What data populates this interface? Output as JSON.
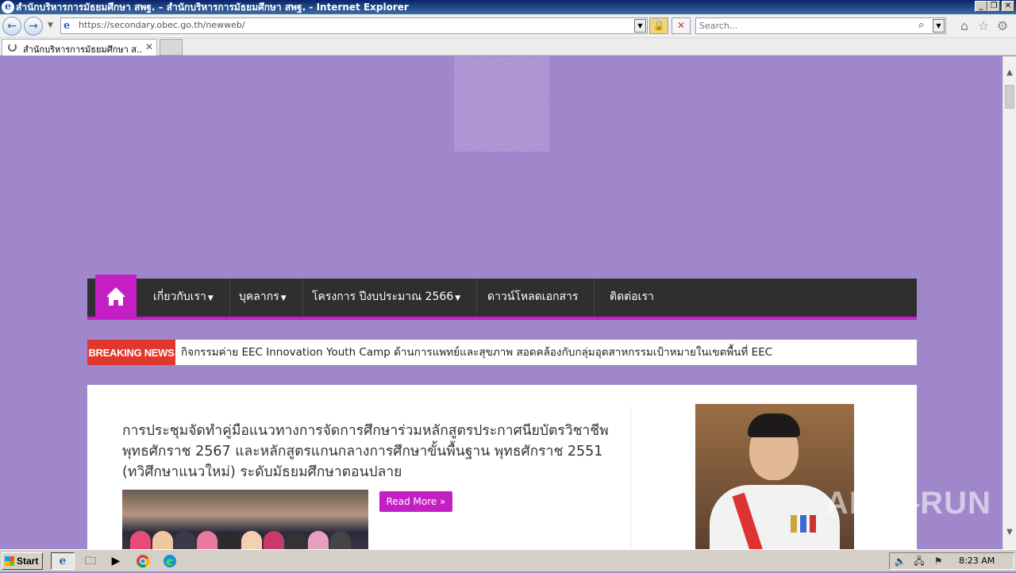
{
  "window": {
    "title": "สำนักบริหารการมัธยมศึกษา สพฐ. – สำนักบริหารการมัธยมศึกษา สพฐ. - Internet Explorer",
    "buttons": {
      "minimize": "_",
      "restore": "❐",
      "close": "✕"
    }
  },
  "addressbar": {
    "url": "https://secondary.obec.go.th/newweb/",
    "search_placeholder": "Search..."
  },
  "tabs": [
    {
      "label": "สำนักบริหารการมัธยมศึกษา ส..."
    }
  ],
  "nav": {
    "items": [
      {
        "label": "เกี่ยวกับเรา",
        "caret": true
      },
      {
        "label": "บุคลากร",
        "caret": true
      },
      {
        "label": "โครงการ  ปีงบประมาณ  2566",
        "caret": true
      },
      {
        "label": "ดาวน์โหลดเอกสาร",
        "caret": false
      },
      {
        "label": "ติดต่อเรา",
        "caret": false
      }
    ],
    "accent": "#c41fc4"
  },
  "breaking": {
    "tag": "BREAKING NEWS",
    "headline": "กิจกรรมค่าย EEC Innovation Youth Camp ด้านการแพทย์และสุขภาพ สอดคล้องกับกลุ่มอุตสาหกรรมเป้าหมายในเขตพื้นที่ EEC"
  },
  "post": {
    "title": "การประชุมจัดทำคู่มือแนวทางการจัดการศึกษาร่วมหลักสูตรประกาศนียบัตรวิชาชีพ พุทธศักราช  2567 และหลักสูตรแกนกลางการศึกษาขั้นพื้นฐาน  พุทธศักราช  2551 (ทวิศึกษาแนวใหม่) ระดับมัธยมศึกษาตอนปลาย",
    "read_more": "Read More »"
  },
  "watermark": "ANY▷RUN",
  "taskbar": {
    "start": "Start",
    "clock": "8:23 AM"
  }
}
